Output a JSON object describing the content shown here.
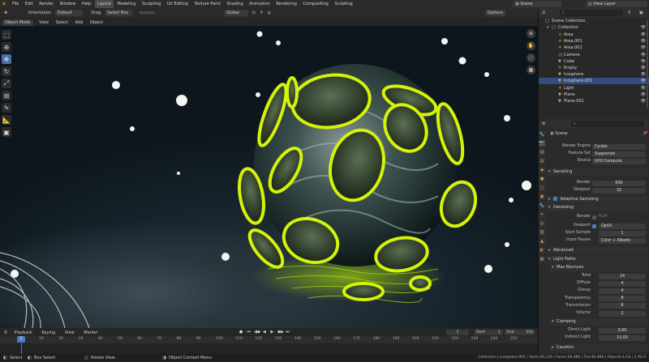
{
  "menu": {
    "items": [
      "File",
      "Edit",
      "Render",
      "Window",
      "Help"
    ],
    "workspaces": [
      "Layout",
      "Modeling",
      "Sculpting",
      "UV Editing",
      "Texture Paint",
      "Shading",
      "Animation",
      "Rendering",
      "Compositing",
      "Scripting"
    ],
    "active_workspace": "Layout",
    "scene_label": "Scene",
    "view_layer_label": "View Layer"
  },
  "viewport_header": {
    "orientation_label": "Orientation",
    "orientation_value": "Default",
    "drag_label": "Drag",
    "drag_value": "Select Box",
    "transform_value": "Global",
    "options_label": "Options",
    "mode": "Object Mode",
    "menus": [
      "View",
      "Select",
      "Add",
      "Object"
    ]
  },
  "toolbar": {
    "tools": [
      "select-box",
      "cursor",
      "move",
      "rotate",
      "scale",
      "transform",
      "annotate",
      "measure",
      "add-cube"
    ],
    "active_tool": "move"
  },
  "timeline": {
    "menus": [
      "Playback",
      "Keying",
      "View",
      "Marker"
    ],
    "current_frame": "2",
    "start_label": "Start",
    "start_value": "1",
    "end_label": "End",
    "end_value": "250",
    "ticks": [
      "0",
      "10",
      "20",
      "30",
      "40",
      "50",
      "60",
      "70",
      "80",
      "90",
      "100",
      "110",
      "120",
      "130",
      "140",
      "150",
      "160",
      "170",
      "180",
      "190",
      "200",
      "210",
      "220",
      "230",
      "240",
      "250"
    ]
  },
  "statusbar": {
    "select": "Select",
    "box_select": "Box Select",
    "rotate_view": "Rotate View",
    "context_menu": "Object Context Menu",
    "stats": "Collection | Icosphere.001 | Verts:20,230 | Faces:20,480 | Tris:40,960 | Objects:1/14 | 2.92.0"
  },
  "outliner": {
    "scene_collection": "Scene Collection",
    "collection": "Collection",
    "items": [
      {
        "name": "Area",
        "icon": "light-icon"
      },
      {
        "name": "Area.001",
        "icon": "light-icon"
      },
      {
        "name": "Area.002",
        "icon": "light-icon"
      },
      {
        "name": "Camera",
        "icon": "camera-icon"
      },
      {
        "name": "Cube",
        "icon": "mesh-icon"
      },
      {
        "name": "Empty",
        "icon": "empty-icon"
      },
      {
        "name": "Icosphere",
        "icon": "mesh-icon"
      },
      {
        "name": "Icosphere.001",
        "icon": "mesh-icon"
      },
      {
        "name": "Light",
        "icon": "light-icon"
      },
      {
        "name": "Plane",
        "icon": "mesh-icon"
      },
      {
        "name": "Plane.001",
        "icon": "mesh-icon"
      }
    ],
    "selected": "Icosphere.001"
  },
  "properties": {
    "context": "Scene",
    "render_engine_label": "Render Engine",
    "render_engine": "Cycles",
    "feature_set_label": "Feature Set",
    "feature_set": "Supported",
    "device_label": "Device",
    "device": "GPU Compute",
    "sampling_section": "Sampling",
    "render_label": "Render",
    "render_samples": "600",
    "viewport_label": "Viewport",
    "viewport_samples": "32",
    "adaptive_sampling": "Adaptive Sampling",
    "denoising_section": "Denoising",
    "denoise_render_label": "Render",
    "denoise_render_value": "NLM",
    "denoise_viewport_label": "Viewport",
    "denoise_viewport_value": "OptiX",
    "start_sample_label": "Start Sample",
    "start_sample": "1",
    "input_passes_label": "Input Passes",
    "input_passes": "Color + Albedo",
    "advanced_section": "Advanced",
    "light_paths_section": "Light Paths",
    "max_bounces_section": "Max Bounces",
    "bounces": [
      {
        "label": "Total",
        "value": "24"
      },
      {
        "label": "Diffuse",
        "value": "4"
      },
      {
        "label": "Glossy",
        "value": "4"
      },
      {
        "label": "Transparency",
        "value": "8"
      },
      {
        "label": "Transmission",
        "value": "6"
      },
      {
        "label": "Volume",
        "value": "2"
      }
    ],
    "clamping_section": "Clamping",
    "direct_light_label": "Direct Light",
    "direct_light": "0.00",
    "indirect_light_label": "Indirect Light",
    "indirect_light": "10.00",
    "caustics_section": "Caustics"
  },
  "colors": {
    "accent": "#4a7cc7",
    "selection_outline": "#d4f20a",
    "selected_row": "#334d80"
  }
}
